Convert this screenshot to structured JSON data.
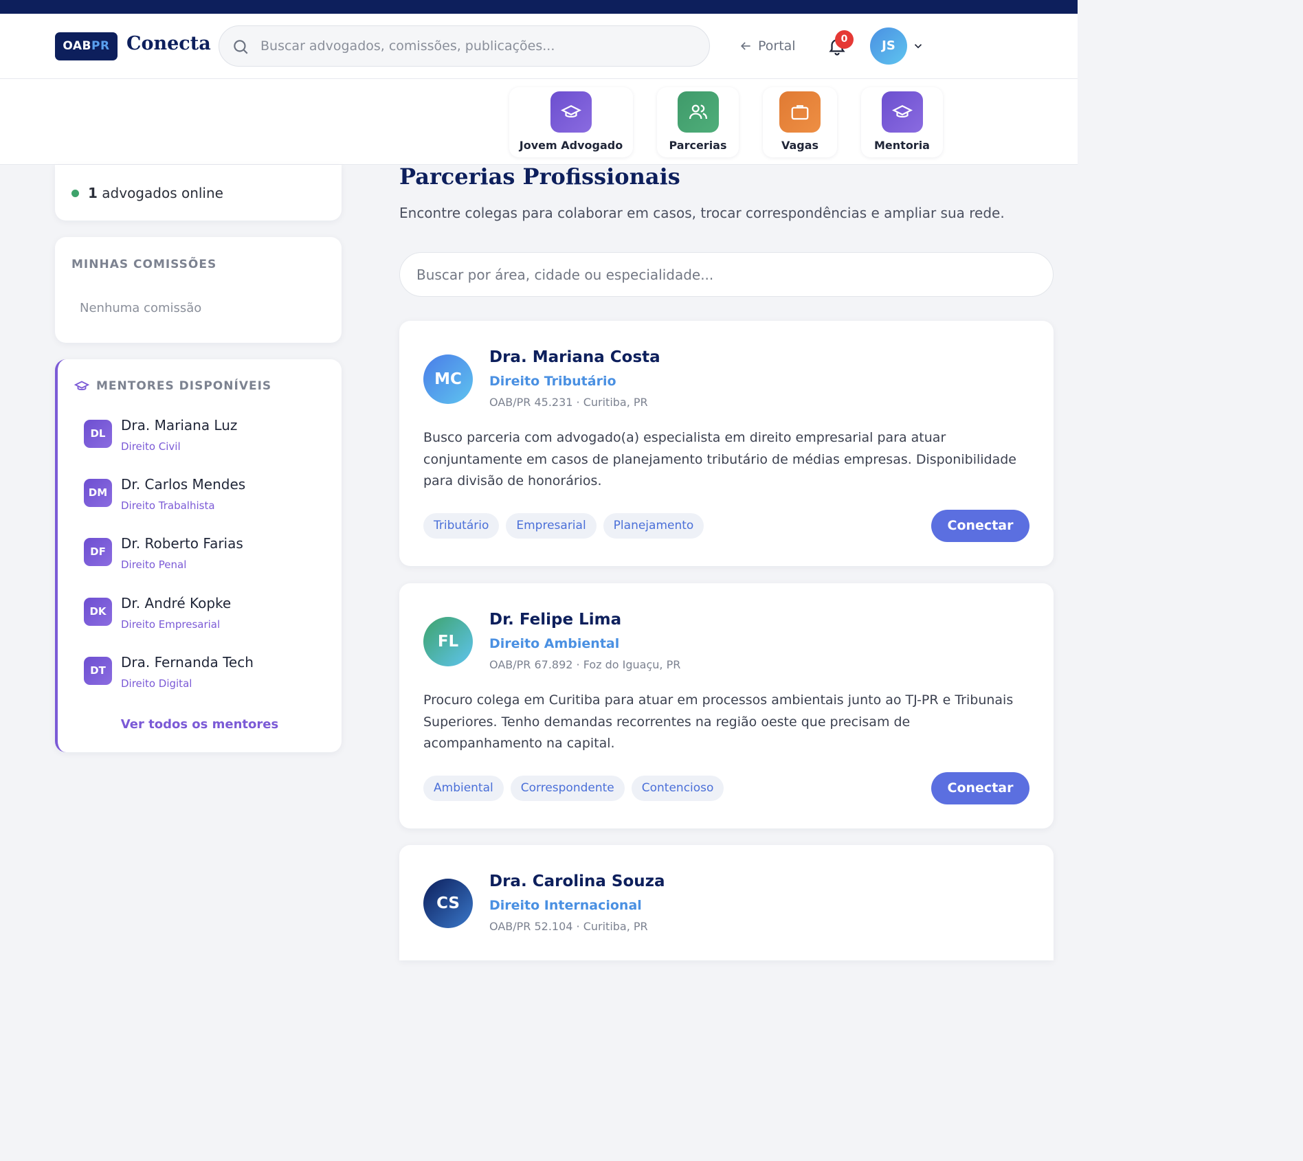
{
  "header": {
    "logo_main": "OAB",
    "logo_pr": "PR",
    "brand": "Conecta",
    "search_placeholder": "Buscar advogados, comissões, publicações...",
    "portal_label": "Portal",
    "notif_count": "0",
    "user_initials": "JS"
  },
  "quick_actions": [
    {
      "label": "Jovem Advogado",
      "icon": "graduation-cap-icon",
      "color": "#6c4fcf"
    },
    {
      "label": "Parcerias",
      "icon": "users-icon",
      "color": "#3f9a6a"
    },
    {
      "label": "Vagas",
      "icon": "briefcase-icon",
      "color": "#e07a33"
    },
    {
      "label": "Mentoria",
      "icon": "graduation-cap-icon",
      "color": "#6c4fcf"
    }
  ],
  "sidebar": {
    "online_count": "1",
    "online_text": "advogados online",
    "commissions_title": "MINHAS COMISSÕES",
    "commissions_empty": "Nenhuma comissão",
    "mentors_title": "MENTORES DISPONÍVEIS",
    "mentors": [
      {
        "initials": "DL",
        "name": "Dra. Mariana Luz",
        "area": "Direito Civil"
      },
      {
        "initials": "DM",
        "name": "Dr. Carlos Mendes",
        "area": "Direito Trabalhista"
      },
      {
        "initials": "DF",
        "name": "Dr. Roberto Farias",
        "area": "Direito Penal"
      },
      {
        "initials": "DK",
        "name": "Dr. André Kopke",
        "area": "Direito Empresarial"
      },
      {
        "initials": "DT",
        "name": "Dra. Fernanda Tech",
        "area": "Direito Digital"
      }
    ],
    "mentors_all": "Ver todos os mentores"
  },
  "main": {
    "title": "Parcerias Profissionais",
    "subtitle": "Encontre colegas para colaborar em casos, trocar correspondências e ampliar sua rede.",
    "filter_placeholder": "Buscar por área, cidade ou especialidade...",
    "connect_label": "Conectar",
    "partners": [
      {
        "initials": "MC",
        "name": "Dra. Mariana Costa",
        "area": "Direito Tributário",
        "meta": "OAB/PR 45.231 · Curitiba, PR",
        "description": "Busco parceria com advogado(a) especialista em direito empresarial para atuar conjuntamente em casos de planejamento tributário de médias empresas. Disponibilidade para divisão de honorários.",
        "tags": [
          "Tributário",
          "Empresarial",
          "Planejamento"
        ],
        "avatar_from": "#4a7de8",
        "avatar_to": "#5fc4ef"
      },
      {
        "initials": "FL",
        "name": "Dr. Felipe Lima",
        "area": "Direito Ambiental",
        "meta": "OAB/PR 67.892 · Foz do Iguaçu, PR",
        "description": "Procuro colega em Curitiba para atuar em processos ambientais junto ao TJ-PR e Tribunais Superiores. Tenho demandas recorrentes na região oeste que precisam de acompanhamento na capital.",
        "tags": [
          "Ambiental",
          "Correspondente",
          "Contencioso"
        ],
        "avatar_from": "#3ea36b",
        "avatar_to": "#5fc4ef"
      },
      {
        "initials": "CS",
        "name": "Dra. Carolina Souza",
        "area": "Direito Internacional",
        "meta": "OAB/PR 52.104 · Curitiba, PR",
        "description": "",
        "tags": [],
        "avatar_from": "#0d1f5c",
        "avatar_to": "#3a78c9"
      }
    ]
  }
}
